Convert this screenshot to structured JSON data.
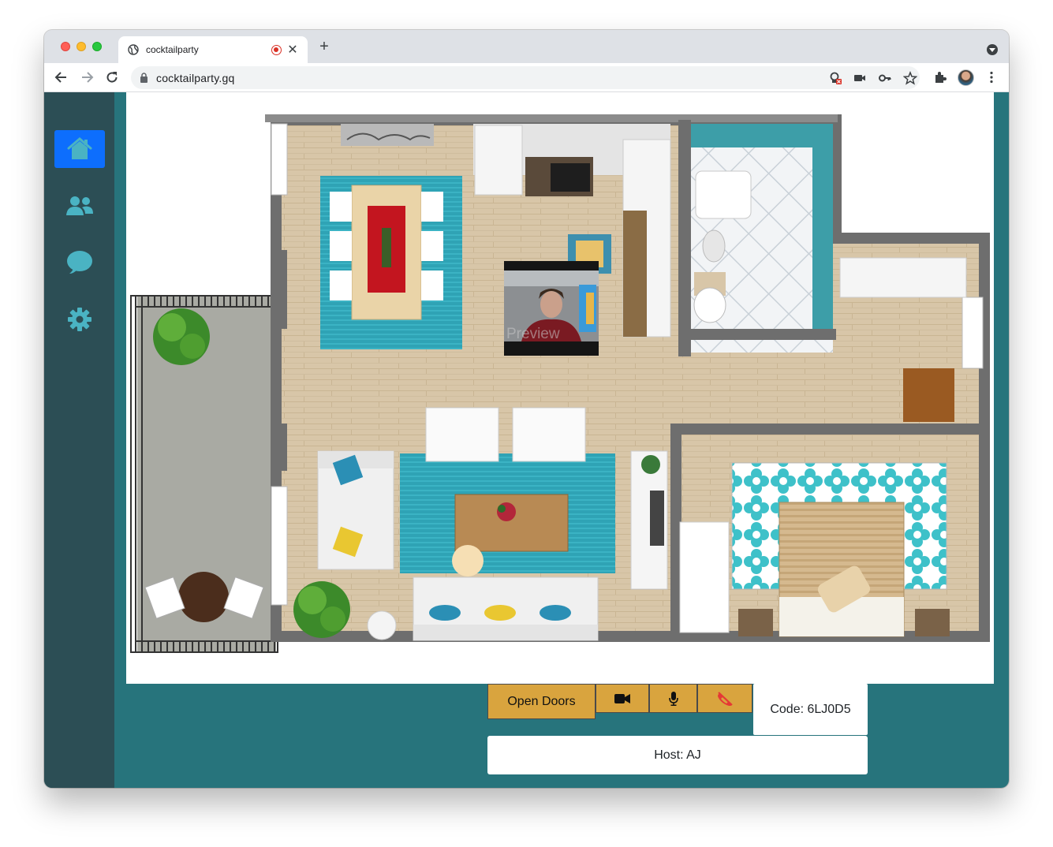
{
  "browser": {
    "tab_title": "cocktailparty",
    "url": "cocktailparty.gq",
    "icons": [
      "globe-icon",
      "recording-icon",
      "close-icon",
      "new-tab-icon",
      "tab-search-icon",
      "back-icon",
      "forward-icon",
      "reload-icon",
      "lock-icon",
      "camera-blocked-icon",
      "video-icon",
      "key-icon",
      "star-icon",
      "extensions-icon",
      "profile-avatar",
      "more-icon"
    ]
  },
  "sidebar": {
    "items": [
      {
        "name": "home",
        "icon": "house-icon",
        "active": true
      },
      {
        "name": "people",
        "icon": "users-icon",
        "active": false
      },
      {
        "name": "chat",
        "icon": "chat-bubble-icon",
        "active": false
      },
      {
        "name": "settings",
        "icon": "gear-icon",
        "active": false
      }
    ]
  },
  "map": {
    "preview_label": "Preview"
  },
  "controls": {
    "open_doors_label": "Open Doors",
    "code_text": "Code: 6LJ0D5",
    "host_text": "Host: AJ",
    "icons": [
      "video-camera-icon",
      "microphone-icon",
      "hang-up-icon"
    ]
  },
  "colors": {
    "page_bg": "#27747c",
    "sidebar_bg": "#2c4e55",
    "active_nav": "#0d6efd",
    "nav_icon": "#4ab3c3",
    "control_button": "#d9a43e",
    "hangup_icon": "#e53935"
  }
}
